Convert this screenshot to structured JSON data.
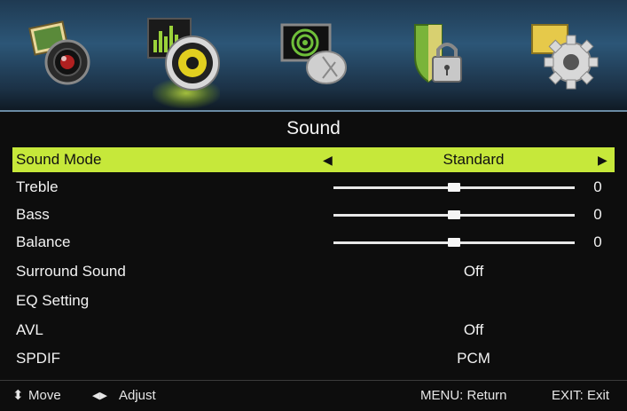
{
  "tabs": [
    {
      "name": "picture",
      "icon": "picture-camera-icon"
    },
    {
      "name": "sound",
      "icon": "speaker-equalizer-icon",
      "active": true
    },
    {
      "name": "channel",
      "icon": "satellite-dish-icon"
    },
    {
      "name": "lock",
      "icon": "shield-padlock-icon"
    },
    {
      "name": "setup",
      "icon": "gear-icon"
    }
  ],
  "page": {
    "title": "Sound"
  },
  "menu": {
    "sound_mode": {
      "label": "Sound Mode",
      "value": "Standard"
    },
    "treble": {
      "label": "Treble",
      "value": "0",
      "level": 0.5
    },
    "bass": {
      "label": "Bass",
      "value": "0",
      "level": 0.5
    },
    "balance": {
      "label": "Balance",
      "value": "0",
      "level": 0.5
    },
    "surround": {
      "label": "Surround Sound",
      "value": "Off"
    },
    "eq": {
      "label": "EQ Setting"
    },
    "avl": {
      "label": "AVL",
      "value": "Off"
    },
    "spdif": {
      "label": "SPDIF",
      "value": "PCM"
    }
  },
  "footer": {
    "move": "Move",
    "adjust": "Adjust",
    "menu_hint": "MENU: Return",
    "exit_hint": "EXIT: Exit"
  },
  "colors": {
    "highlight": "#c6e83a",
    "bar": "#2c5677"
  }
}
